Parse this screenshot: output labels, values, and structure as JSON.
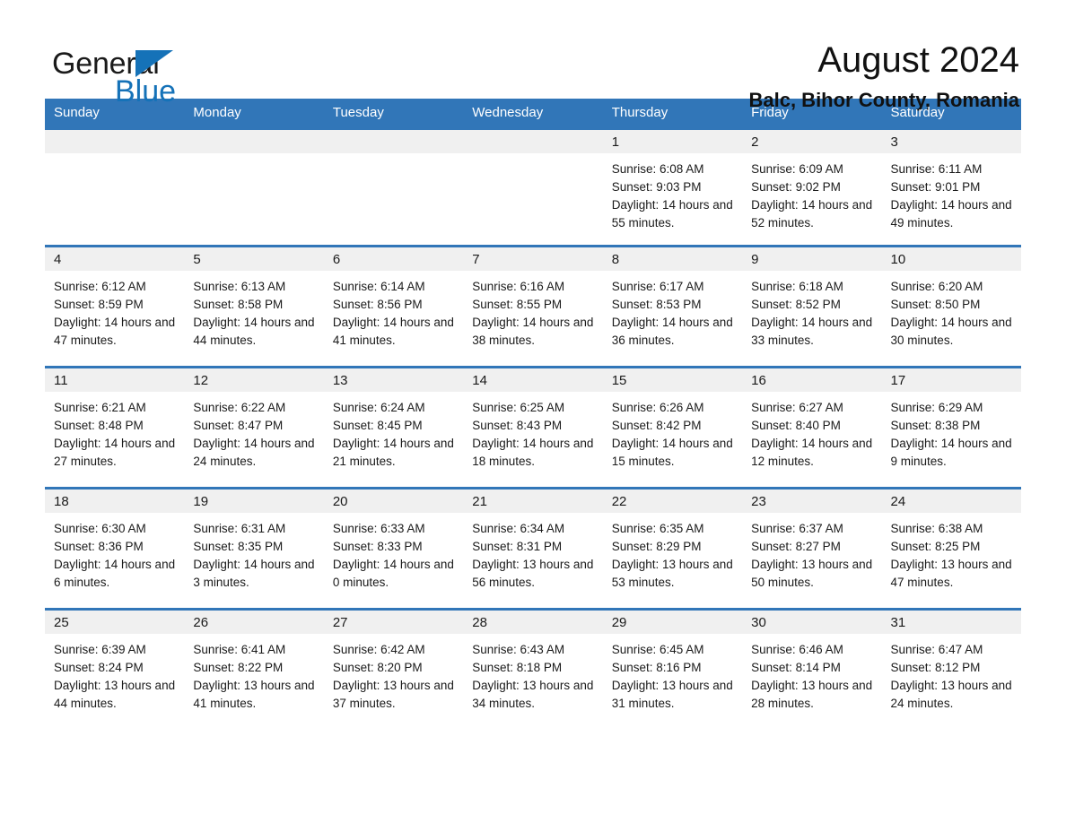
{
  "brand": {
    "name_part1": "General",
    "name_part2": "Blue"
  },
  "header": {
    "title": "August 2024",
    "subtitle": "Balc, Bihor County, Romania"
  },
  "colors": {
    "header_blue": "#3176b8",
    "logo_blue": "#1572b8",
    "daynum_band": "#f0f0f0"
  },
  "labels": {
    "sunrise_prefix": "Sunrise:",
    "sunset_prefix": "Sunset:",
    "daylight_prefix": "Daylight:"
  },
  "weekdays": [
    "Sunday",
    "Monday",
    "Tuesday",
    "Wednesday",
    "Thursday",
    "Friday",
    "Saturday"
  ],
  "weeks": [
    [
      {
        "empty": true
      },
      {
        "empty": true
      },
      {
        "empty": true
      },
      {
        "empty": true
      },
      {
        "day": "1",
        "sunrise": "Sunrise: 6:08 AM",
        "sunset": "Sunset: 9:03 PM",
        "daylight": "Daylight: 14 hours and 55 minutes."
      },
      {
        "day": "2",
        "sunrise": "Sunrise: 6:09 AM",
        "sunset": "Sunset: 9:02 PM",
        "daylight": "Daylight: 14 hours and 52 minutes."
      },
      {
        "day": "3",
        "sunrise": "Sunrise: 6:11 AM",
        "sunset": "Sunset: 9:01 PM",
        "daylight": "Daylight: 14 hours and 49 minutes."
      }
    ],
    [
      {
        "day": "4",
        "sunrise": "Sunrise: 6:12 AM",
        "sunset": "Sunset: 8:59 PM",
        "daylight": "Daylight: 14 hours and 47 minutes."
      },
      {
        "day": "5",
        "sunrise": "Sunrise: 6:13 AM",
        "sunset": "Sunset: 8:58 PM",
        "daylight": "Daylight: 14 hours and 44 minutes."
      },
      {
        "day": "6",
        "sunrise": "Sunrise: 6:14 AM",
        "sunset": "Sunset: 8:56 PM",
        "daylight": "Daylight: 14 hours and 41 minutes."
      },
      {
        "day": "7",
        "sunrise": "Sunrise: 6:16 AM",
        "sunset": "Sunset: 8:55 PM",
        "daylight": "Daylight: 14 hours and 38 minutes."
      },
      {
        "day": "8",
        "sunrise": "Sunrise: 6:17 AM",
        "sunset": "Sunset: 8:53 PM",
        "daylight": "Daylight: 14 hours and 36 minutes."
      },
      {
        "day": "9",
        "sunrise": "Sunrise: 6:18 AM",
        "sunset": "Sunset: 8:52 PM",
        "daylight": "Daylight: 14 hours and 33 minutes."
      },
      {
        "day": "10",
        "sunrise": "Sunrise: 6:20 AM",
        "sunset": "Sunset: 8:50 PM",
        "daylight": "Daylight: 14 hours and 30 minutes."
      }
    ],
    [
      {
        "day": "11",
        "sunrise": "Sunrise: 6:21 AM",
        "sunset": "Sunset: 8:48 PM",
        "daylight": "Daylight: 14 hours and 27 minutes."
      },
      {
        "day": "12",
        "sunrise": "Sunrise: 6:22 AM",
        "sunset": "Sunset: 8:47 PM",
        "daylight": "Daylight: 14 hours and 24 minutes."
      },
      {
        "day": "13",
        "sunrise": "Sunrise: 6:24 AM",
        "sunset": "Sunset: 8:45 PM",
        "daylight": "Daylight: 14 hours and 21 minutes."
      },
      {
        "day": "14",
        "sunrise": "Sunrise: 6:25 AM",
        "sunset": "Sunset: 8:43 PM",
        "daylight": "Daylight: 14 hours and 18 minutes."
      },
      {
        "day": "15",
        "sunrise": "Sunrise: 6:26 AM",
        "sunset": "Sunset: 8:42 PM",
        "daylight": "Daylight: 14 hours and 15 minutes."
      },
      {
        "day": "16",
        "sunrise": "Sunrise: 6:27 AM",
        "sunset": "Sunset: 8:40 PM",
        "daylight": "Daylight: 14 hours and 12 minutes."
      },
      {
        "day": "17",
        "sunrise": "Sunrise: 6:29 AM",
        "sunset": "Sunset: 8:38 PM",
        "daylight": "Daylight: 14 hours and 9 minutes."
      }
    ],
    [
      {
        "day": "18",
        "sunrise": "Sunrise: 6:30 AM",
        "sunset": "Sunset: 8:36 PM",
        "daylight": "Daylight: 14 hours and 6 minutes."
      },
      {
        "day": "19",
        "sunrise": "Sunrise: 6:31 AM",
        "sunset": "Sunset: 8:35 PM",
        "daylight": "Daylight: 14 hours and 3 minutes."
      },
      {
        "day": "20",
        "sunrise": "Sunrise: 6:33 AM",
        "sunset": "Sunset: 8:33 PM",
        "daylight": "Daylight: 14 hours and 0 minutes."
      },
      {
        "day": "21",
        "sunrise": "Sunrise: 6:34 AM",
        "sunset": "Sunset: 8:31 PM",
        "daylight": "Daylight: 13 hours and 56 minutes."
      },
      {
        "day": "22",
        "sunrise": "Sunrise: 6:35 AM",
        "sunset": "Sunset: 8:29 PM",
        "daylight": "Daylight: 13 hours and 53 minutes."
      },
      {
        "day": "23",
        "sunrise": "Sunrise: 6:37 AM",
        "sunset": "Sunset: 8:27 PM",
        "daylight": "Daylight: 13 hours and 50 minutes."
      },
      {
        "day": "24",
        "sunrise": "Sunrise: 6:38 AM",
        "sunset": "Sunset: 8:25 PM",
        "daylight": "Daylight: 13 hours and 47 minutes."
      }
    ],
    [
      {
        "day": "25",
        "sunrise": "Sunrise: 6:39 AM",
        "sunset": "Sunset: 8:24 PM",
        "daylight": "Daylight: 13 hours and 44 minutes."
      },
      {
        "day": "26",
        "sunrise": "Sunrise: 6:41 AM",
        "sunset": "Sunset: 8:22 PM",
        "daylight": "Daylight: 13 hours and 41 minutes."
      },
      {
        "day": "27",
        "sunrise": "Sunrise: 6:42 AM",
        "sunset": "Sunset: 8:20 PM",
        "daylight": "Daylight: 13 hours and 37 minutes."
      },
      {
        "day": "28",
        "sunrise": "Sunrise: 6:43 AM",
        "sunset": "Sunset: 8:18 PM",
        "daylight": "Daylight: 13 hours and 34 minutes."
      },
      {
        "day": "29",
        "sunrise": "Sunrise: 6:45 AM",
        "sunset": "Sunset: 8:16 PM",
        "daylight": "Daylight: 13 hours and 31 minutes."
      },
      {
        "day": "30",
        "sunrise": "Sunrise: 6:46 AM",
        "sunset": "Sunset: 8:14 PM",
        "daylight": "Daylight: 13 hours and 28 minutes."
      },
      {
        "day": "31",
        "sunrise": "Sunrise: 6:47 AM",
        "sunset": "Sunset: 8:12 PM",
        "daylight": "Daylight: 13 hours and 24 minutes."
      }
    ]
  ]
}
